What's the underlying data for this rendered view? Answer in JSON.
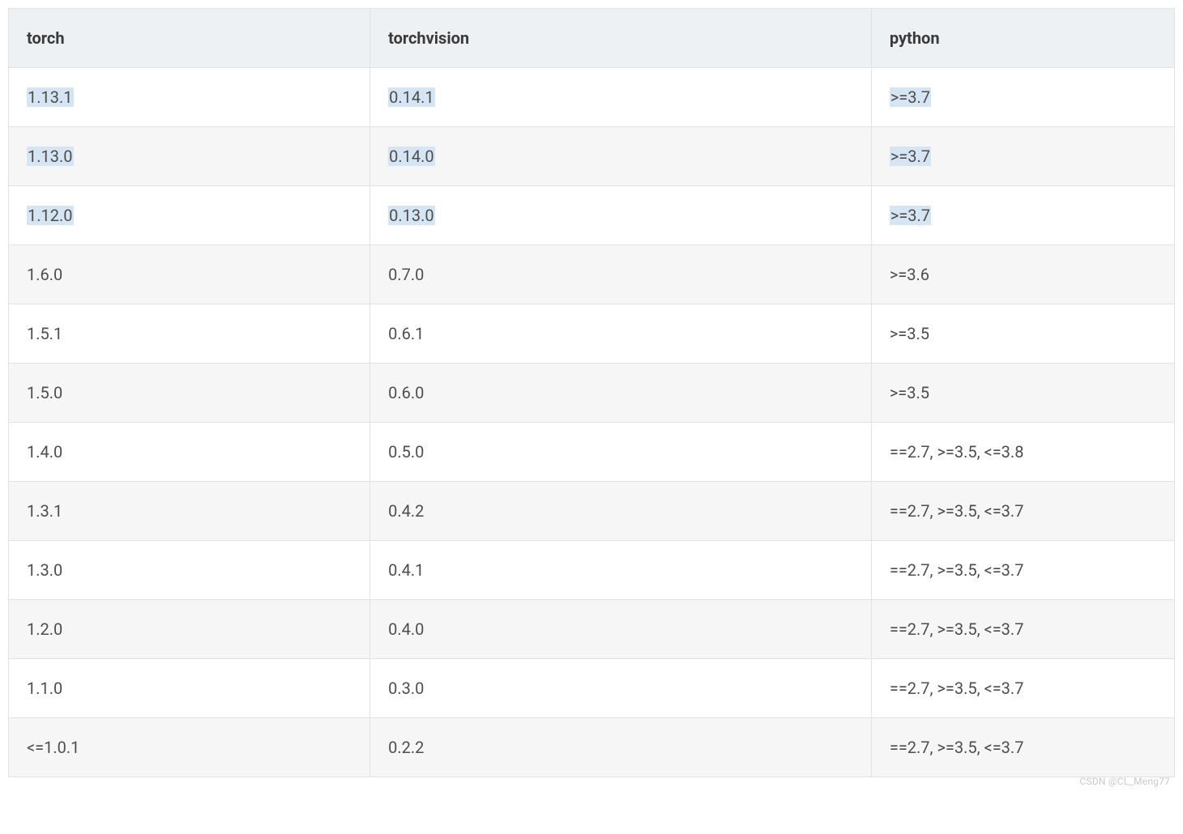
{
  "table": {
    "headers": [
      "torch",
      "torchvision",
      "python"
    ],
    "rows": [
      {
        "torch": "1.13.1",
        "torchvision": "0.14.1",
        "python": ">=3.7",
        "highlighted": true
      },
      {
        "torch": "1.13.0",
        "torchvision": "0.14.0",
        "python": ">=3.7",
        "highlighted": true
      },
      {
        "torch": "1.12.0",
        "torchvision": "0.13.0",
        "python": ">=3.7",
        "highlighted": true
      },
      {
        "torch": "1.6.0",
        "torchvision": "0.7.0",
        "python": ">=3.6",
        "highlighted": false
      },
      {
        "torch": "1.5.1",
        "torchvision": "0.6.1",
        "python": ">=3.5",
        "highlighted": false
      },
      {
        "torch": "1.5.0",
        "torchvision": "0.6.0",
        "python": ">=3.5",
        "highlighted": false
      },
      {
        "torch": "1.4.0",
        "torchvision": "0.5.0",
        "python": "==2.7, >=3.5, <=3.8",
        "highlighted": false
      },
      {
        "torch": "1.3.1",
        "torchvision": "0.4.2",
        "python": "==2.7, >=3.5, <=3.7",
        "highlighted": false
      },
      {
        "torch": "1.3.0",
        "torchvision": "0.4.1",
        "python": "==2.7, >=3.5, <=3.7",
        "highlighted": false
      },
      {
        "torch": "1.2.0",
        "torchvision": "0.4.0",
        "python": "==2.7, >=3.5, <=3.7",
        "highlighted": false
      },
      {
        "torch": "1.1.0",
        "torchvision": "0.3.0",
        "python": "==2.7, >=3.5, <=3.7",
        "highlighted": false
      },
      {
        "torch": "<=1.0.1",
        "torchvision": "0.2.2",
        "python": "==2.7, >=3.5, <=3.7",
        "highlighted": false
      }
    ]
  },
  "watermark": "CSDN @CL_Meng77"
}
